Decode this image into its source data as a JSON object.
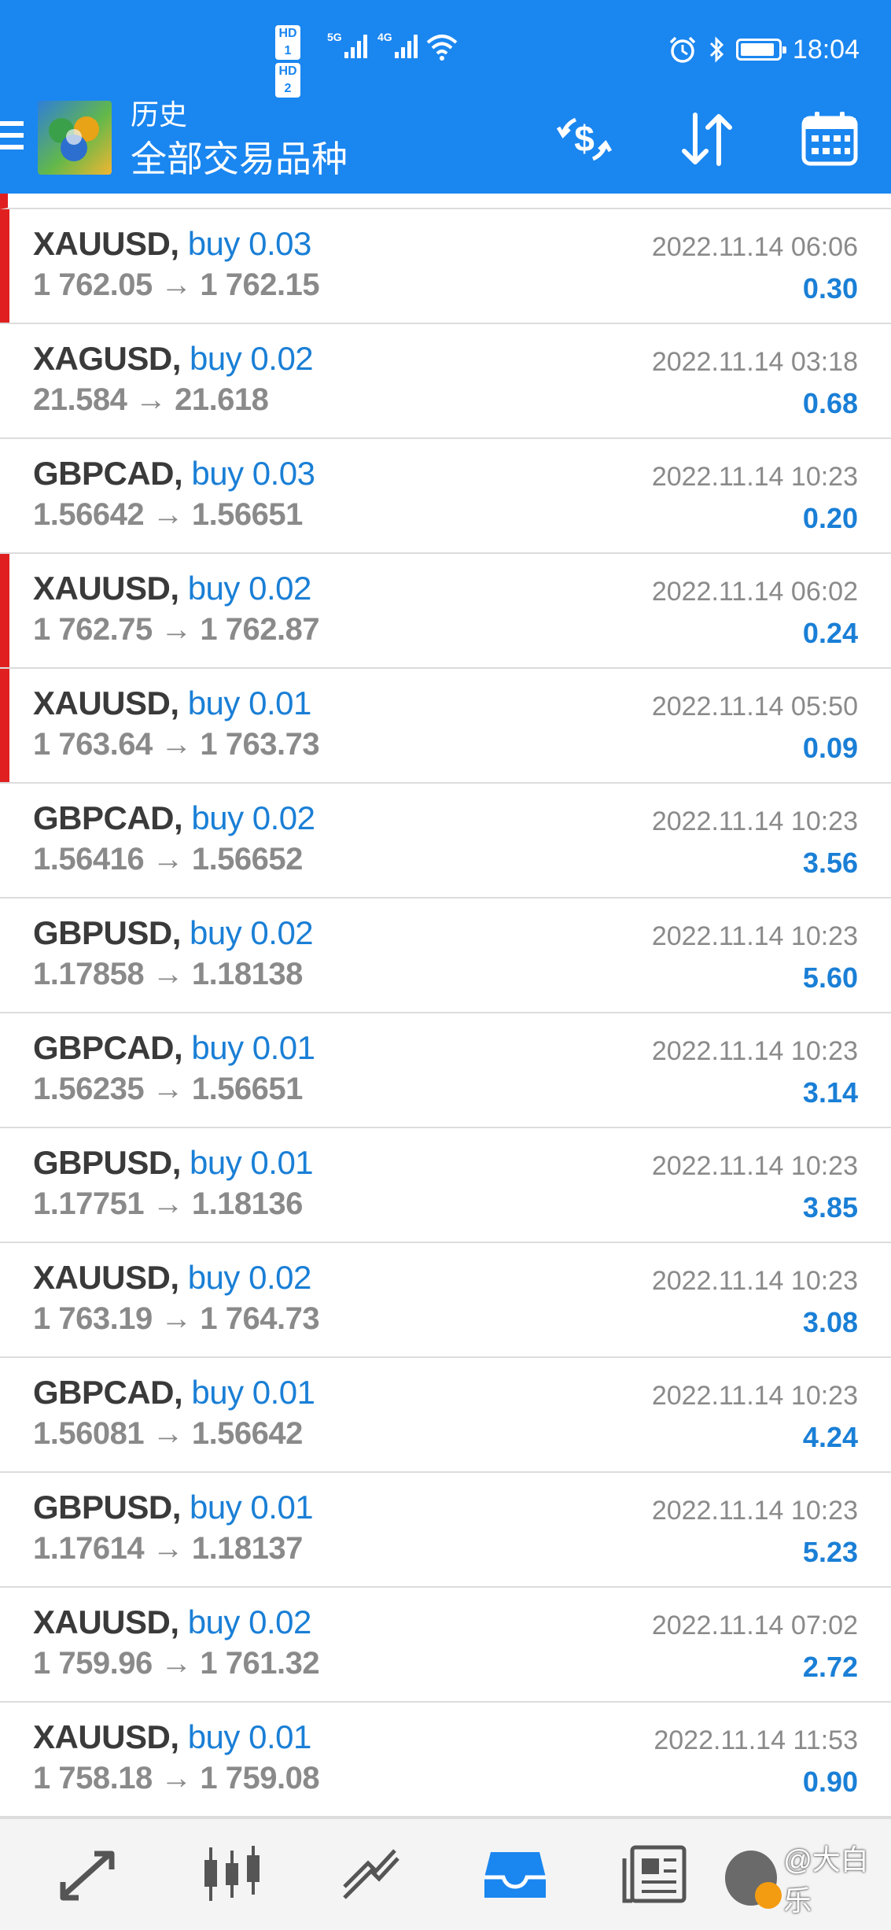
{
  "status_bar": {
    "hd1": "HD 1",
    "hd2": "HD 2",
    "net1": "5G",
    "net2": "4G",
    "time": "18:04"
  },
  "header": {
    "title": "历史",
    "subtitle": "全部交易品种",
    "icons": [
      "menu-icon",
      "app-logo",
      "currency-exchange-icon",
      "sort-icon",
      "calendar-icon"
    ]
  },
  "trades": [
    {
      "symbol": "XAUUSD,",
      "side": "buy 0.03",
      "prices": "1 762.05 → 1 762.15",
      "time": "2022.11.14 06:06",
      "profit": "0.30",
      "flag": true
    },
    {
      "symbol": "XAGUSD,",
      "side": "buy 0.02",
      "prices": "21.584 → 21.618",
      "time": "2022.11.14 03:18",
      "profit": "0.68",
      "flag": false
    },
    {
      "symbol": "GBPCAD,",
      "side": "buy 0.03",
      "prices": "1.56642 → 1.56651",
      "time": "2022.11.14 10:23",
      "profit": "0.20",
      "flag": false
    },
    {
      "symbol": "XAUUSD,",
      "side": "buy 0.02",
      "prices": "1 762.75 → 1 762.87",
      "time": "2022.11.14 06:02",
      "profit": "0.24",
      "flag": true
    },
    {
      "symbol": "XAUUSD,",
      "side": "buy 0.01",
      "prices": "1 763.64 → 1 763.73",
      "time": "2022.11.14 05:50",
      "profit": "0.09",
      "flag": true
    },
    {
      "symbol": "GBPCAD,",
      "side": "buy 0.02",
      "prices": "1.56416 → 1.56652",
      "time": "2022.11.14 10:23",
      "profit": "3.56",
      "flag": false
    },
    {
      "symbol": "GBPUSD,",
      "side": "buy 0.02",
      "prices": "1.17858 → 1.18138",
      "time": "2022.11.14 10:23",
      "profit": "5.60",
      "flag": false
    },
    {
      "symbol": "GBPCAD,",
      "side": "buy 0.01",
      "prices": "1.56235 → 1.56651",
      "time": "2022.11.14 10:23",
      "profit": "3.14",
      "flag": false
    },
    {
      "symbol": "GBPUSD,",
      "side": "buy 0.01",
      "prices": "1.17751 → 1.18136",
      "time": "2022.11.14 10:23",
      "profit": "3.85",
      "flag": false
    },
    {
      "symbol": "XAUUSD,",
      "side": "buy 0.02",
      "prices": "1 763.19 → 1 764.73",
      "time": "2022.11.14 10:23",
      "profit": "3.08",
      "flag": false
    },
    {
      "symbol": "GBPCAD,",
      "side": "buy 0.01",
      "prices": "1.56081 → 1.56642",
      "time": "2022.11.14 10:23",
      "profit": "4.24",
      "flag": false
    },
    {
      "symbol": "GBPUSD,",
      "side": "buy 0.01",
      "prices": "1.17614 → 1.18137",
      "time": "2022.11.14 10:23",
      "profit": "5.23",
      "flag": false
    },
    {
      "symbol": "XAUUSD,",
      "side": "buy 0.02",
      "prices": "1 759.96 → 1 761.32",
      "time": "2022.11.14 07:02",
      "profit": "2.72",
      "flag": false
    },
    {
      "symbol": "XAUUSD,",
      "side": "buy 0.01",
      "prices": "1 758.18 → 1 759.08",
      "time": "2022.11.14 11:53",
      "profit": "0.90",
      "flag": false
    }
  ],
  "bottom_nav": {
    "items": [
      "quotes-icon",
      "chart-icon",
      "trade-icon",
      "history-icon",
      "news-icon"
    ],
    "active": "history-icon",
    "watermark": "@大白乐"
  },
  "colors": {
    "primary": "#1a86f0",
    "buy": "#1a7fd6",
    "flag": "#e02020",
    "muted": "#8a8a8a"
  }
}
